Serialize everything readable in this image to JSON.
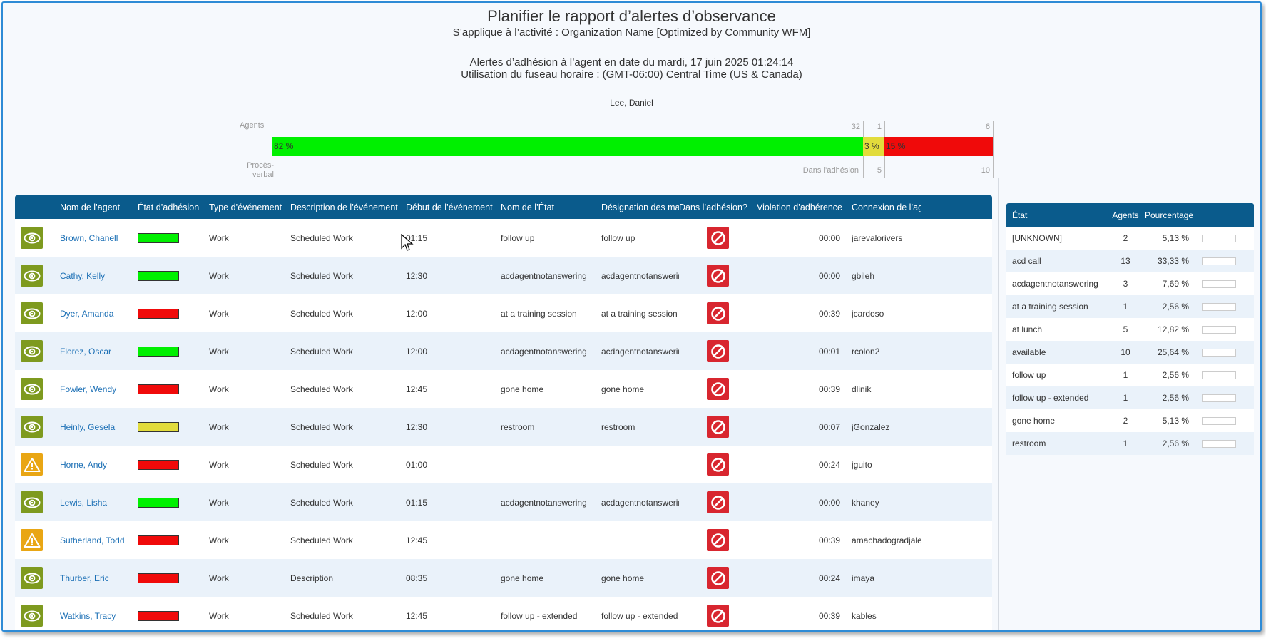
{
  "header": {
    "title": "Planifier le rapport d’alertes d’observance",
    "subtitle": "S’applique à l’activité : Organization Name [Optimized by Community WFM]",
    "alert_line": "Alertes d’adhésion à l’agent en date du mardi, 17 juin 2025 01:24:14",
    "timezone_line": "Utilisation du fuseau horaire : (GMT-06:00) Central Time (US & Canada)",
    "supervisor": "Lee, Daniel"
  },
  "summary": {
    "agents_label": "Agents",
    "proces_label_1": "Procès-",
    "proces_label_2": "verbal",
    "dans_label": "Dans l’adhésion",
    "counts": {
      "green": "32",
      "yellow": "1",
      "red": "6"
    },
    "dans_counts": {
      "yellow": "5",
      "red": "10"
    },
    "segments": [
      {
        "label": "82 %",
        "fraction": 0.82,
        "color": "#00f000"
      },
      {
        "label": "3 %",
        "fraction": 0.03,
        "color": "#e2dc3c"
      },
      {
        "label": "15 %",
        "fraction": 0.15,
        "color": "#f00a0a"
      }
    ]
  },
  "table": {
    "headers": [
      "Nom de l’agent",
      "État d’adhésion",
      "Type d’événement",
      "Description de l’événement",
      "Début de l’événement",
      "Nom de l’État",
      "Désignation des marchandises",
      "Dans l’adhésion?",
      "Violation d’adhérence",
      "Connexion de l’agent"
    ],
    "rows": [
      {
        "icon": "eye-icon",
        "name": "Brown, Chanell",
        "adh_color": "#00f000",
        "type": "Work",
        "desc": "Scheduled Work",
        "start": "01:15",
        "state": "follow up",
        "designation": "follow up",
        "violation": "00:00",
        "login": "jarevalorivers"
      },
      {
        "icon": "eye-icon",
        "name": "Cathy, Kelly",
        "adh_color": "#00f000",
        "type": "Work",
        "desc": "Scheduled Work",
        "start": "12:30",
        "state": "acdagentnotanswering",
        "designation": "acdagentnotanswering",
        "violation": "00:00",
        "login": "gbileh"
      },
      {
        "icon": "eye-icon",
        "name": "Dyer, Amanda",
        "adh_color": "#f00a0a",
        "type": "Work",
        "desc": "Scheduled Work",
        "start": "12:00",
        "state": "at a training session",
        "designation": "at a training session",
        "violation": "00:39",
        "login": "jcardoso"
      },
      {
        "icon": "eye-icon",
        "name": "Florez, Oscar",
        "adh_color": "#00f000",
        "type": "Work",
        "desc": "Scheduled Work",
        "start": "12:00",
        "state": "acdagentnotanswering",
        "designation": "acdagentnotanswering",
        "violation": "00:01",
        "login": "rcolon2"
      },
      {
        "icon": "eye-icon",
        "name": "Fowler, Wendy",
        "adh_color": "#f00a0a",
        "type": "Work",
        "desc": "Scheduled Work",
        "start": "12:45",
        "state": "gone home",
        "designation": "gone home",
        "violation": "00:39",
        "login": "dlinik"
      },
      {
        "icon": "eye-icon",
        "name": "Heinly, Gesela",
        "adh_color": "#e2dc3c",
        "type": "Work",
        "desc": "Scheduled Work",
        "start": "12:30",
        "state": "restroom",
        "designation": "restroom",
        "violation": "00:07",
        "login": "jGonzalez"
      },
      {
        "icon": "warning-icon",
        "name": "Horne, Andy",
        "adh_color": "#f00a0a",
        "type": "Work",
        "desc": "Scheduled Work",
        "start": "01:00",
        "state": "",
        "designation": "",
        "violation": "00:24",
        "login": "jguito"
      },
      {
        "icon": "eye-icon",
        "name": "Lewis, Lisha",
        "adh_color": "#00f000",
        "type": "Work",
        "desc": "Scheduled Work",
        "start": "01:15",
        "state": "acdagentnotanswering",
        "designation": "acdagentnotanswering",
        "violation": "00:00",
        "login": "khaney"
      },
      {
        "icon": "warning-icon",
        "name": "Sutherland, Todd",
        "adh_color": "#f00a0a",
        "type": "Work",
        "desc": "Scheduled Work",
        "start": "12:45",
        "state": "",
        "designation": "",
        "violation": "00:39",
        "login": "amachadogradjales"
      },
      {
        "icon": "eye-icon",
        "name": "Thurber, Eric",
        "adh_color": "#f00a0a",
        "type": "Work",
        "desc": "Description",
        "start": "08:35",
        "state": "gone home",
        "designation": "gone home",
        "violation": "00:24",
        "login": "imaya"
      },
      {
        "icon": "eye-icon",
        "name": "Watkins, Tracy",
        "adh_color": "#f00a0a",
        "type": "Work",
        "desc": "Scheduled Work",
        "start": "12:45",
        "state": "follow up - extended",
        "designation": "follow up - extended",
        "violation": "00:39",
        "login": "kables"
      }
    ]
  },
  "side": {
    "headers": [
      "État",
      "Agents",
      "Pourcentage"
    ],
    "rows": [
      {
        "state": "[UNKNOWN]",
        "agents": "2",
        "pct": "5,13 %"
      },
      {
        "state": "acd call",
        "agents": "13",
        "pct": "33,33 %"
      },
      {
        "state": "acdagentnotanswering",
        "agents": "3",
        "pct": "7,69 %"
      },
      {
        "state": "at a training session",
        "agents": "1",
        "pct": "2,56 %"
      },
      {
        "state": "at lunch",
        "agents": "5",
        "pct": "12,82 %"
      },
      {
        "state": "available",
        "agents": "10",
        "pct": "25,64 %"
      },
      {
        "state": "follow up",
        "agents": "1",
        "pct": "2,56 %"
      },
      {
        "state": "follow up - extended",
        "agents": "1",
        "pct": "2,56 %"
      },
      {
        "state": "gone home",
        "agents": "2",
        "pct": "5,13 %"
      },
      {
        "state": "restroom",
        "agents": "1",
        "pct": "2,56 %"
      }
    ]
  }
}
